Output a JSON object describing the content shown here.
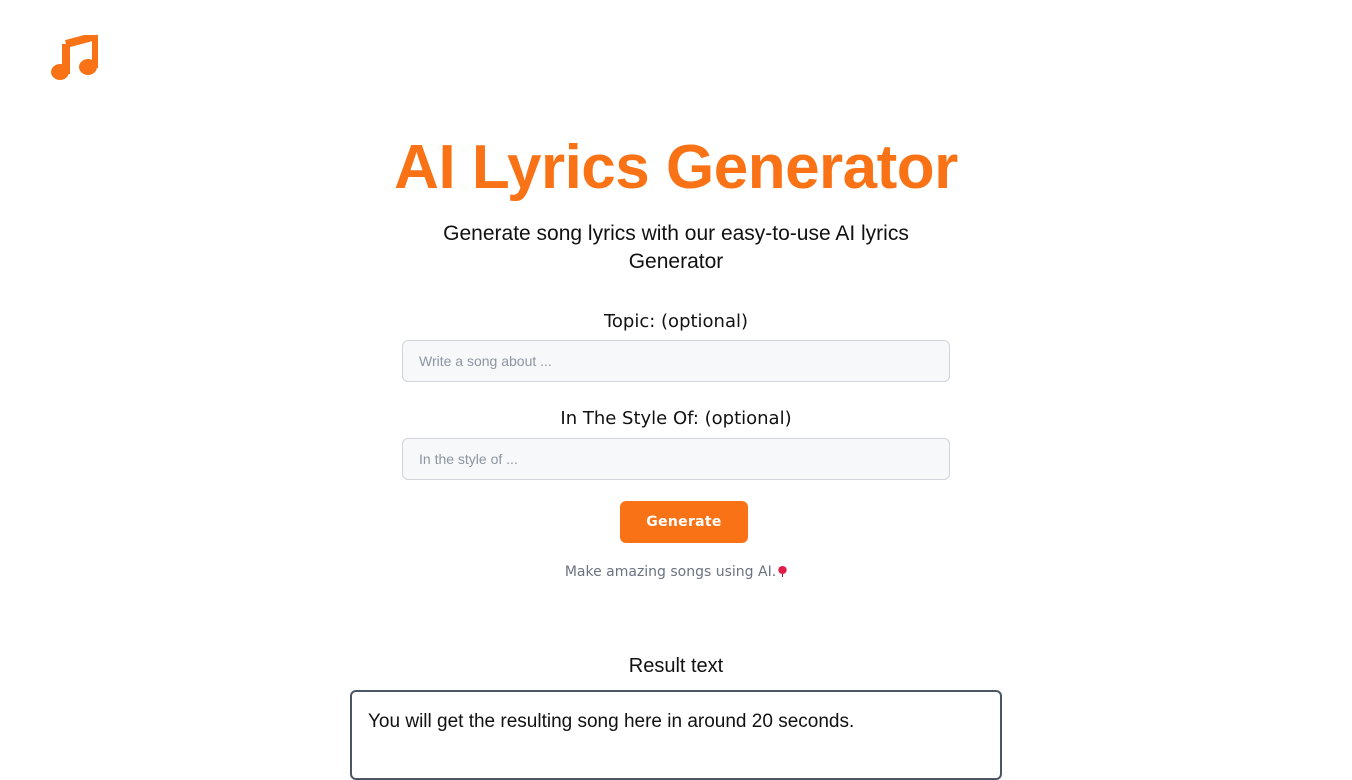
{
  "colors": {
    "accent": "#f97316",
    "balloon": "#e11d48"
  },
  "logo": {
    "icon": "music-note-icon"
  },
  "header": {
    "title": "AI Lyrics Generator",
    "subtitle": "Generate song lyrics with our easy-to-use AI lyrics Generator"
  },
  "form": {
    "topic_label": "Topic: (optional)",
    "topic_placeholder": "Write a song about ...",
    "style_label": "In The Style Of: (optional)",
    "style_placeholder": "In the style of ...",
    "generate_label": "Generate"
  },
  "tagline": {
    "text": "Make amazing songs using AI.",
    "icon": "balloon-icon"
  },
  "result": {
    "label": "Result text",
    "text": "You will get the resulting song here in around 20 seconds."
  }
}
